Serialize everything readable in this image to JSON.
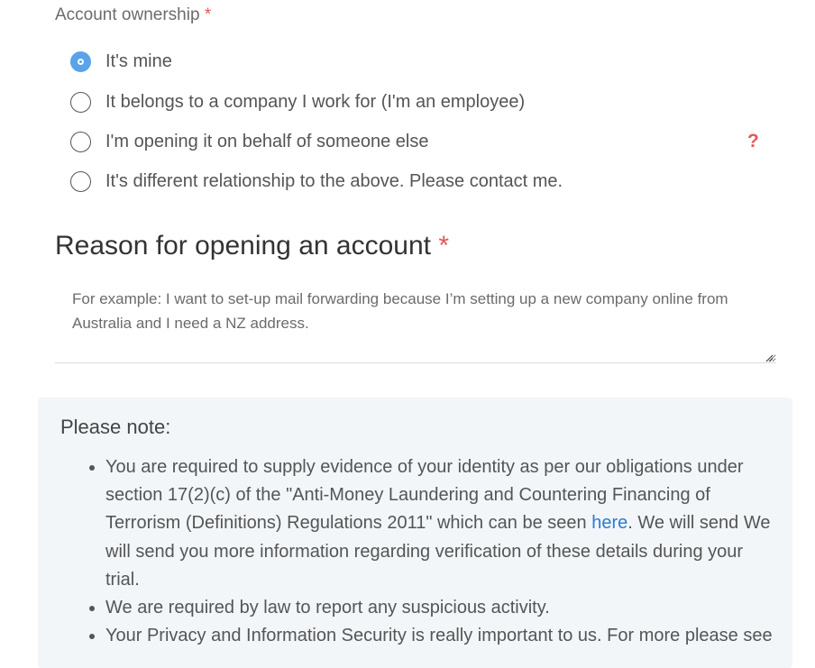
{
  "ownership": {
    "label": "Account ownership",
    "required_mark": "*",
    "options": [
      {
        "label": "It's mine",
        "selected": true
      },
      {
        "label": "It belongs to a company I work for (I'm an employee)",
        "selected": false
      },
      {
        "label": "I'm opening it on behalf of someone else",
        "selected": false
      },
      {
        "label": "It's different relationship to the above. Please contact me.",
        "selected": false
      }
    ],
    "help_icon": "?"
  },
  "reason": {
    "heading": "Reason for opening an account",
    "required_mark": "*",
    "value": "",
    "placeholder": "For example: I want to set-up mail forwarding because I’m setting up a new company online from Australia and I need a NZ address."
  },
  "note": {
    "title": "Please note:",
    "item1_before_link": "You are required to supply evidence of your identity as per our obligations under section 17(2)(c) of the \"Anti-Money Laundering and Countering Financing of Terrorism (Definitions) Regulations 2011\" which can be seen ",
    "item1_link": "here",
    "item1_after_link": ". We will send We will send you more information regarding verification of these details during your trial.",
    "item2": "We are required by law to report any suspicious activity.",
    "item3": "Your Privacy and Information Security is really important to us. For more please see"
  },
  "colors": {
    "accent": "#5aa3e8",
    "required": "#e45858",
    "link": "#2a7bd3",
    "panel_bg": "#f2f6f9"
  }
}
